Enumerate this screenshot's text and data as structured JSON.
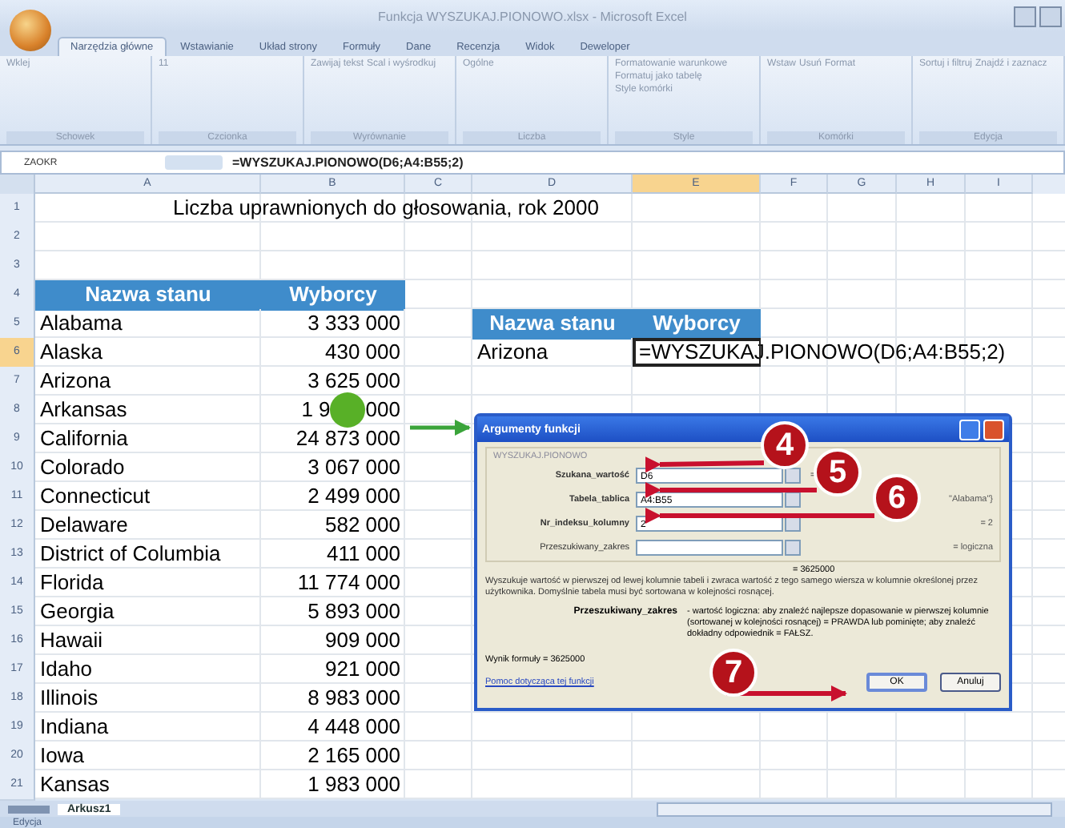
{
  "window": {
    "title": "Funkcja WYSZUKAJ.PIONOWO.xlsx - Microsoft Excel"
  },
  "ribbon_tabs": [
    {
      "label": "Narzędzia główne",
      "selected": true
    },
    {
      "label": "Wstawianie",
      "selected": false
    },
    {
      "label": "Układ strony",
      "selected": false
    },
    {
      "label": "Formuły",
      "selected": false
    },
    {
      "label": "Dane",
      "selected": false
    },
    {
      "label": "Recenzja",
      "selected": false
    },
    {
      "label": "Widok",
      "selected": false
    },
    {
      "label": "Deweloper",
      "selected": false
    }
  ],
  "ribbon_groups": [
    {
      "name": "Schowek",
      "buttons": [
        "Wklej"
      ]
    },
    {
      "name": "Czcionka",
      "buttons": [
        "11"
      ]
    },
    {
      "name": "Wyrównanie",
      "buttons": [
        "Zawijaj tekst",
        "Scal i wyśrodkuj"
      ]
    },
    {
      "name": "Liczba",
      "buttons": [
        "Ogólne"
      ]
    },
    {
      "name": "Style",
      "buttons": [
        "Formatowanie warunkowe",
        "Formatuj jako tabelę",
        "Style komórki"
      ]
    },
    {
      "name": "Komórki",
      "buttons": [
        "Wstaw",
        "Usuń",
        "Format"
      ]
    },
    {
      "name": "Edycja",
      "buttons": [
        "Sortuj i filtruj",
        "Znajdź i zaznacz"
      ]
    }
  ],
  "formula_bar": {
    "name_box": "ZAOKR",
    "formula": "=WYSZUKAJ.PIONOWO(D6;A4:B55;2)"
  },
  "columns": [
    {
      "label": "A",
      "selected": false
    },
    {
      "label": "B",
      "selected": false
    },
    {
      "label": "C",
      "selected": false
    },
    {
      "label": "D",
      "selected": false
    },
    {
      "label": "E",
      "selected": true
    },
    {
      "label": "F",
      "selected": false
    },
    {
      "label": "G",
      "selected": false
    },
    {
      "label": "H",
      "selected": false
    },
    {
      "label": "I",
      "selected": false
    }
  ],
  "rows": [
    {
      "number": "1",
      "selected": false,
      "title": "Liczba uprawnionych do głosowania, rok 2000"
    },
    {
      "number": "2",
      "selected": false
    },
    {
      "number": "3",
      "selected": false
    },
    {
      "number": "4",
      "selected": false,
      "left": {
        "kind": "header",
        "a": "Nazwa stanu",
        "b": "Wyborcy"
      }
    },
    {
      "number": "5",
      "selected": false,
      "left": {
        "kind": "data",
        "a": "Alabama",
        "b": "3 333 000"
      },
      "right": {
        "kind": "header",
        "d": "Nazwa stanu",
        "e": "Wyborcy"
      }
    },
    {
      "number": "6",
      "selected": true,
      "left": {
        "kind": "data",
        "a": "Alaska",
        "b": "430 000"
      },
      "right": {
        "kind": "formula",
        "d": "Arizona",
        "e": "=WYSZUKAJ.PIONOWO(D6;A4:B55;2)"
      }
    },
    {
      "number": "7",
      "selected": false,
      "left": {
        "kind": "data",
        "a": "Arizona",
        "b": "3 625 000"
      }
    },
    {
      "number": "8",
      "selected": false,
      "left": {
        "kind": "split",
        "a": "Arkansas",
        "b": "1 9",
        "b2": "000"
      }
    },
    {
      "number": "9",
      "selected": false,
      "left": {
        "kind": "data",
        "a": "California",
        "b": "24 873 000"
      }
    },
    {
      "number": "10",
      "selected": false,
      "left": {
        "kind": "data",
        "a": "Colorado",
        "b": "3 067 000"
      }
    },
    {
      "number": "11",
      "selected": false,
      "left": {
        "kind": "data",
        "a": "Connecticut",
        "b": "2 499 000"
      }
    },
    {
      "number": "12",
      "selected": false,
      "left": {
        "kind": "data",
        "a": "Delaware",
        "b": "582 000"
      }
    },
    {
      "number": "13",
      "selected": false,
      "left": {
        "kind": "data",
        "a": "District of Columbia",
        "b": "411 000"
      }
    },
    {
      "number": "14",
      "selected": false,
      "left": {
        "kind": "data",
        "a": "Florida",
        "b": "11 774 000"
      }
    },
    {
      "number": "15",
      "selected": false,
      "left": {
        "kind": "data",
        "a": "Georgia",
        "b": "5 893 000"
      }
    },
    {
      "number": "16",
      "selected": false,
      "left": {
        "kind": "data",
        "a": "Hawaii",
        "b": "909 000"
      }
    },
    {
      "number": "17",
      "selected": false,
      "left": {
        "kind": "data",
        "a": "Idaho",
        "b": "921 000"
      }
    },
    {
      "number": "18",
      "selected": false,
      "left": {
        "kind": "data",
        "a": "Illinois",
        "b": "8 983 000"
      }
    },
    {
      "number": "19",
      "selected": false,
      "left": {
        "kind": "data",
        "a": "Indiana",
        "b": "4 448 000"
      }
    },
    {
      "number": "20",
      "selected": false,
      "left": {
        "kind": "data",
        "a": "Iowa",
        "b": "2 165 000"
      }
    },
    {
      "number": "21",
      "selected": false,
      "left": {
        "kind": "data",
        "a": "Kansas",
        "b": "1 983 000"
      }
    }
  ],
  "dialog": {
    "title": "Argumenty funkcji",
    "function": "WYSZUKAJ.PIONOWO",
    "arguments": [
      {
        "label": "Szukana_wartość",
        "value": "D6",
        "result": "=",
        "bold": true
      },
      {
        "label": "Tabela_tablica",
        "value": "A4:B55",
        "result": "\"Alabama\"}",
        "bold": true
      },
      {
        "label": "Nr_indeksu_kolumny",
        "value": "2",
        "result": "= 2",
        "bold": true
      },
      {
        "label": "Przeszukiwany_zakres",
        "result": "= logiczna",
        "bold": false
      }
    ],
    "result": "= 3625000",
    "description": "Wyszukuje wartość w pierwszej od lewej kolumnie tabeli i zwraca wartość z tego samego wiersza w kolumnie określonej przez użytkownika. Domyślnie tabela musi być sortowana w kolejności rosnącej.",
    "param_name": "Przeszukiwany_zakres",
    "param_help": "- wartość logiczna: aby znaleźć najlepsze dopasowanie w pierwszej kolumnie (sortowanej w kolejności rosnącej) = PRAWDA lub pominięte; aby znaleźć dokładny odpowiednik = FAŁSZ.",
    "formula_result": "Wynik formuły =   3625000",
    "help_link": "Pomoc dotycząca tej funkcji",
    "buttons": [
      "OK",
      "Anuluj"
    ]
  },
  "callouts": [
    "4",
    "5",
    "6",
    "7"
  ],
  "sheet_tabs": [
    {
      "label": "Arkusz1",
      "selected": true
    }
  ],
  "status_bar": {
    "mode": "Edycja"
  }
}
